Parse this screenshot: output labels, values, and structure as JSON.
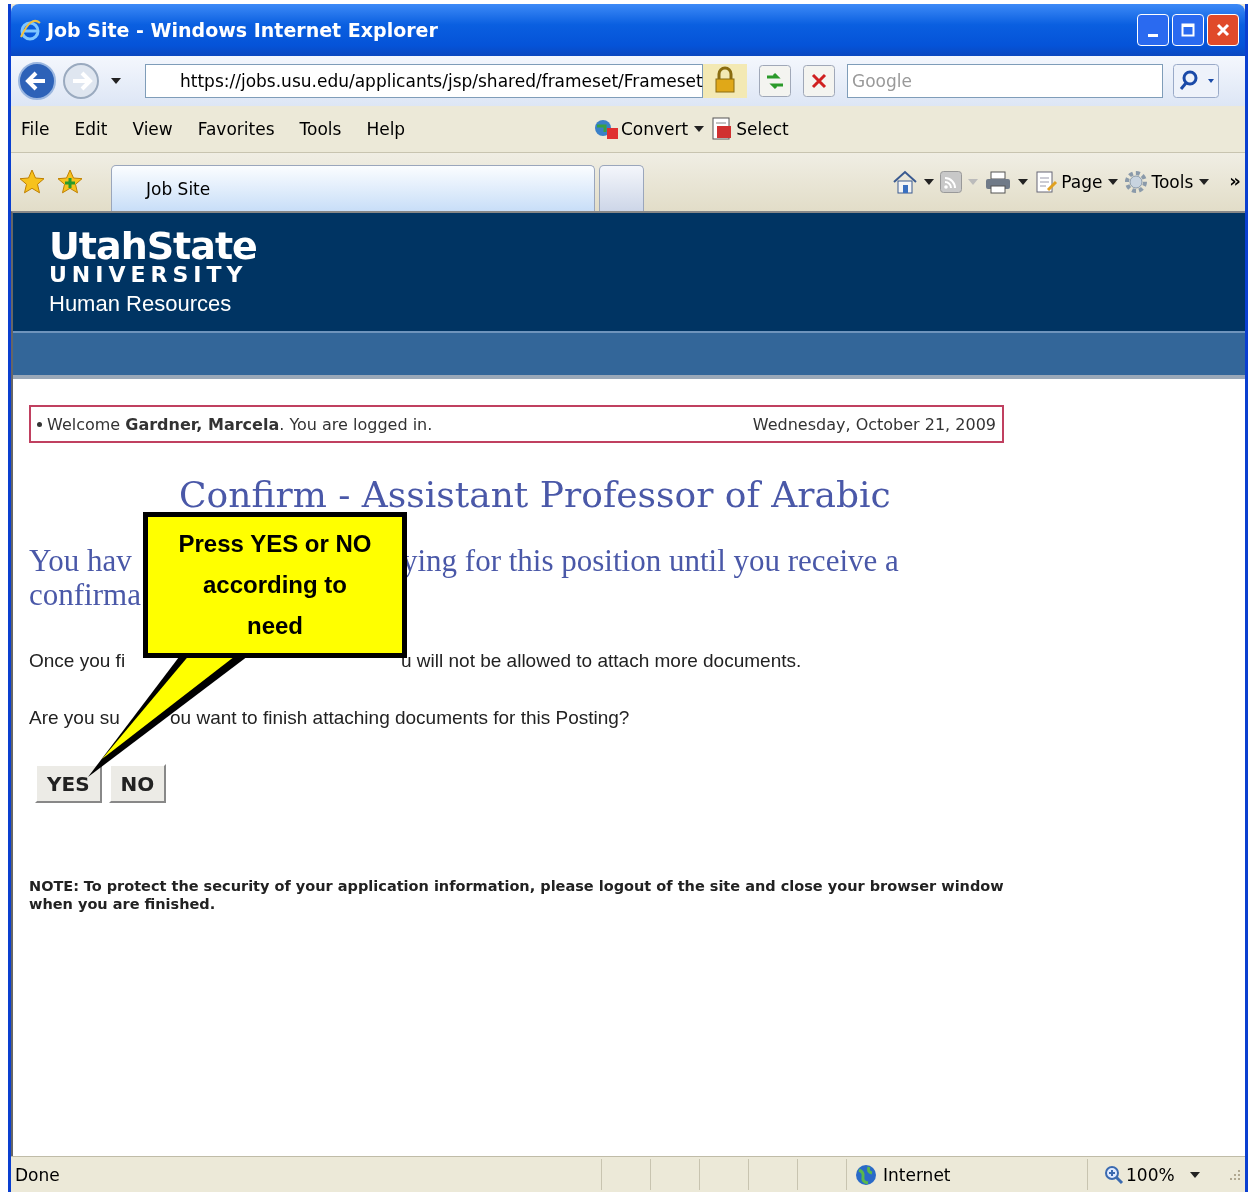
{
  "window": {
    "title": "Job Site - Windows Internet Explorer"
  },
  "address_bar": {
    "value": "https://jobs.usu.edu/applicants/jsp/shared/frameset/Frameset"
  },
  "search": {
    "placeholder": "Google"
  },
  "menu": [
    "File",
    "Edit",
    "View",
    "Favorites",
    "Tools",
    "Help"
  ],
  "addons": [
    "Convert",
    "Select"
  ],
  "tabs": [
    {
      "label": "Job Site",
      "selected": true
    },
    {
      "selected": false
    }
  ],
  "command_bar": [
    "Page",
    "Tools"
  ],
  "chevron": "»",
  "header": {
    "logo": "UtahState",
    "logo_sub": "UNIVERSITY",
    "department": "Human Resources"
  },
  "welcome": {
    "text": "Welcome **Gardner, Marcela**. You are logged in.",
    "date": "Wednesday, October 21, 2009"
  },
  "heading": "Confirm - Assistant Professor of Arabic",
  "intro_lines": [
    {
      "segments": [
        "You hav",
        "ying for this position until you receive a"
      ]
    },
    {
      "segments": [
        "confirma"
      ]
    }
  ],
  "body_lines": [
    {
      "segments": [
        "Once you fi",
        "u will not be allowed to attach more documents."
      ]
    },
    {
      "segments": [
        "Are you su",
        "ou want to finish attaching documents for this Posting?"
      ]
    }
  ],
  "buttons": [
    "YES",
    "NO"
  ],
  "note": "**NOTE:**   **To protect the security of your application information, please logout of the site and close your browser window when you are finished.**",
  "callout": "Press YES or NO according to need",
  "status_bar": {
    "text": "Done",
    "zone": "Internet",
    "zoom": "100%"
  }
}
